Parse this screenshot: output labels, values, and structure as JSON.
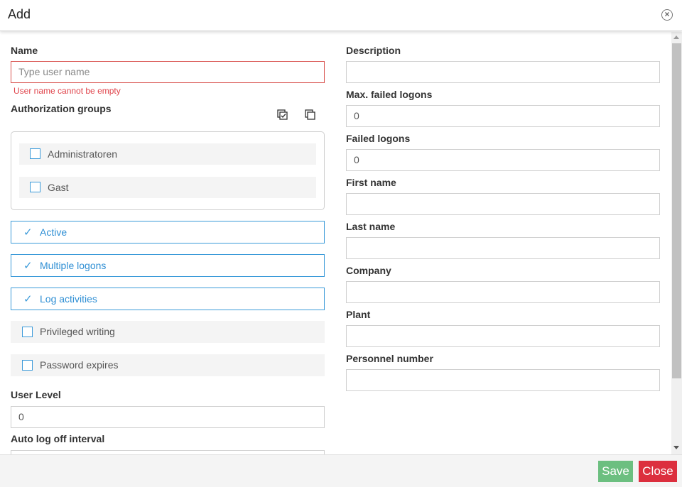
{
  "dialog": {
    "title": "Add",
    "close_icon": "circle-x-icon"
  },
  "left": {
    "name": {
      "label": "Name",
      "value": "",
      "placeholder": "Type user name",
      "error": "User name cannot be empty"
    },
    "authorization_groups": {
      "label": "Authorization groups",
      "select_all_icon": "select-all-icon",
      "deselect_all_icon": "deselect-all-icon",
      "items": [
        {
          "label": "Administratoren",
          "checked": false
        },
        {
          "label": "Gast",
          "checked": false
        }
      ]
    },
    "toggles": [
      {
        "label": "Active",
        "checked": true
      },
      {
        "label": "Multiple logons",
        "checked": true
      },
      {
        "label": "Log activities",
        "checked": true
      },
      {
        "label": "Privileged writing",
        "checked": false
      },
      {
        "label": "Password expires",
        "checked": false
      }
    ],
    "user_level": {
      "label": "User Level",
      "value": "0"
    },
    "auto_log_off": {
      "label": "Auto log off interval",
      "value": ""
    }
  },
  "right": {
    "fields": [
      {
        "label": "Description",
        "value": ""
      },
      {
        "label": "Max. failed logons",
        "value": "0"
      },
      {
        "label": "Failed logons",
        "value": "0"
      },
      {
        "label": "First name",
        "value": ""
      },
      {
        "label": "Last name",
        "value": ""
      },
      {
        "label": "Company",
        "value": ""
      },
      {
        "label": "Plant",
        "value": ""
      },
      {
        "label": "Personnel number",
        "value": ""
      }
    ]
  },
  "footer": {
    "save_label": "Save",
    "close_label": "Close"
  },
  "colors": {
    "accent": "#3b9ad9",
    "error": "#e0434a",
    "save": "#6cbf80",
    "close": "#dc2f3e"
  }
}
